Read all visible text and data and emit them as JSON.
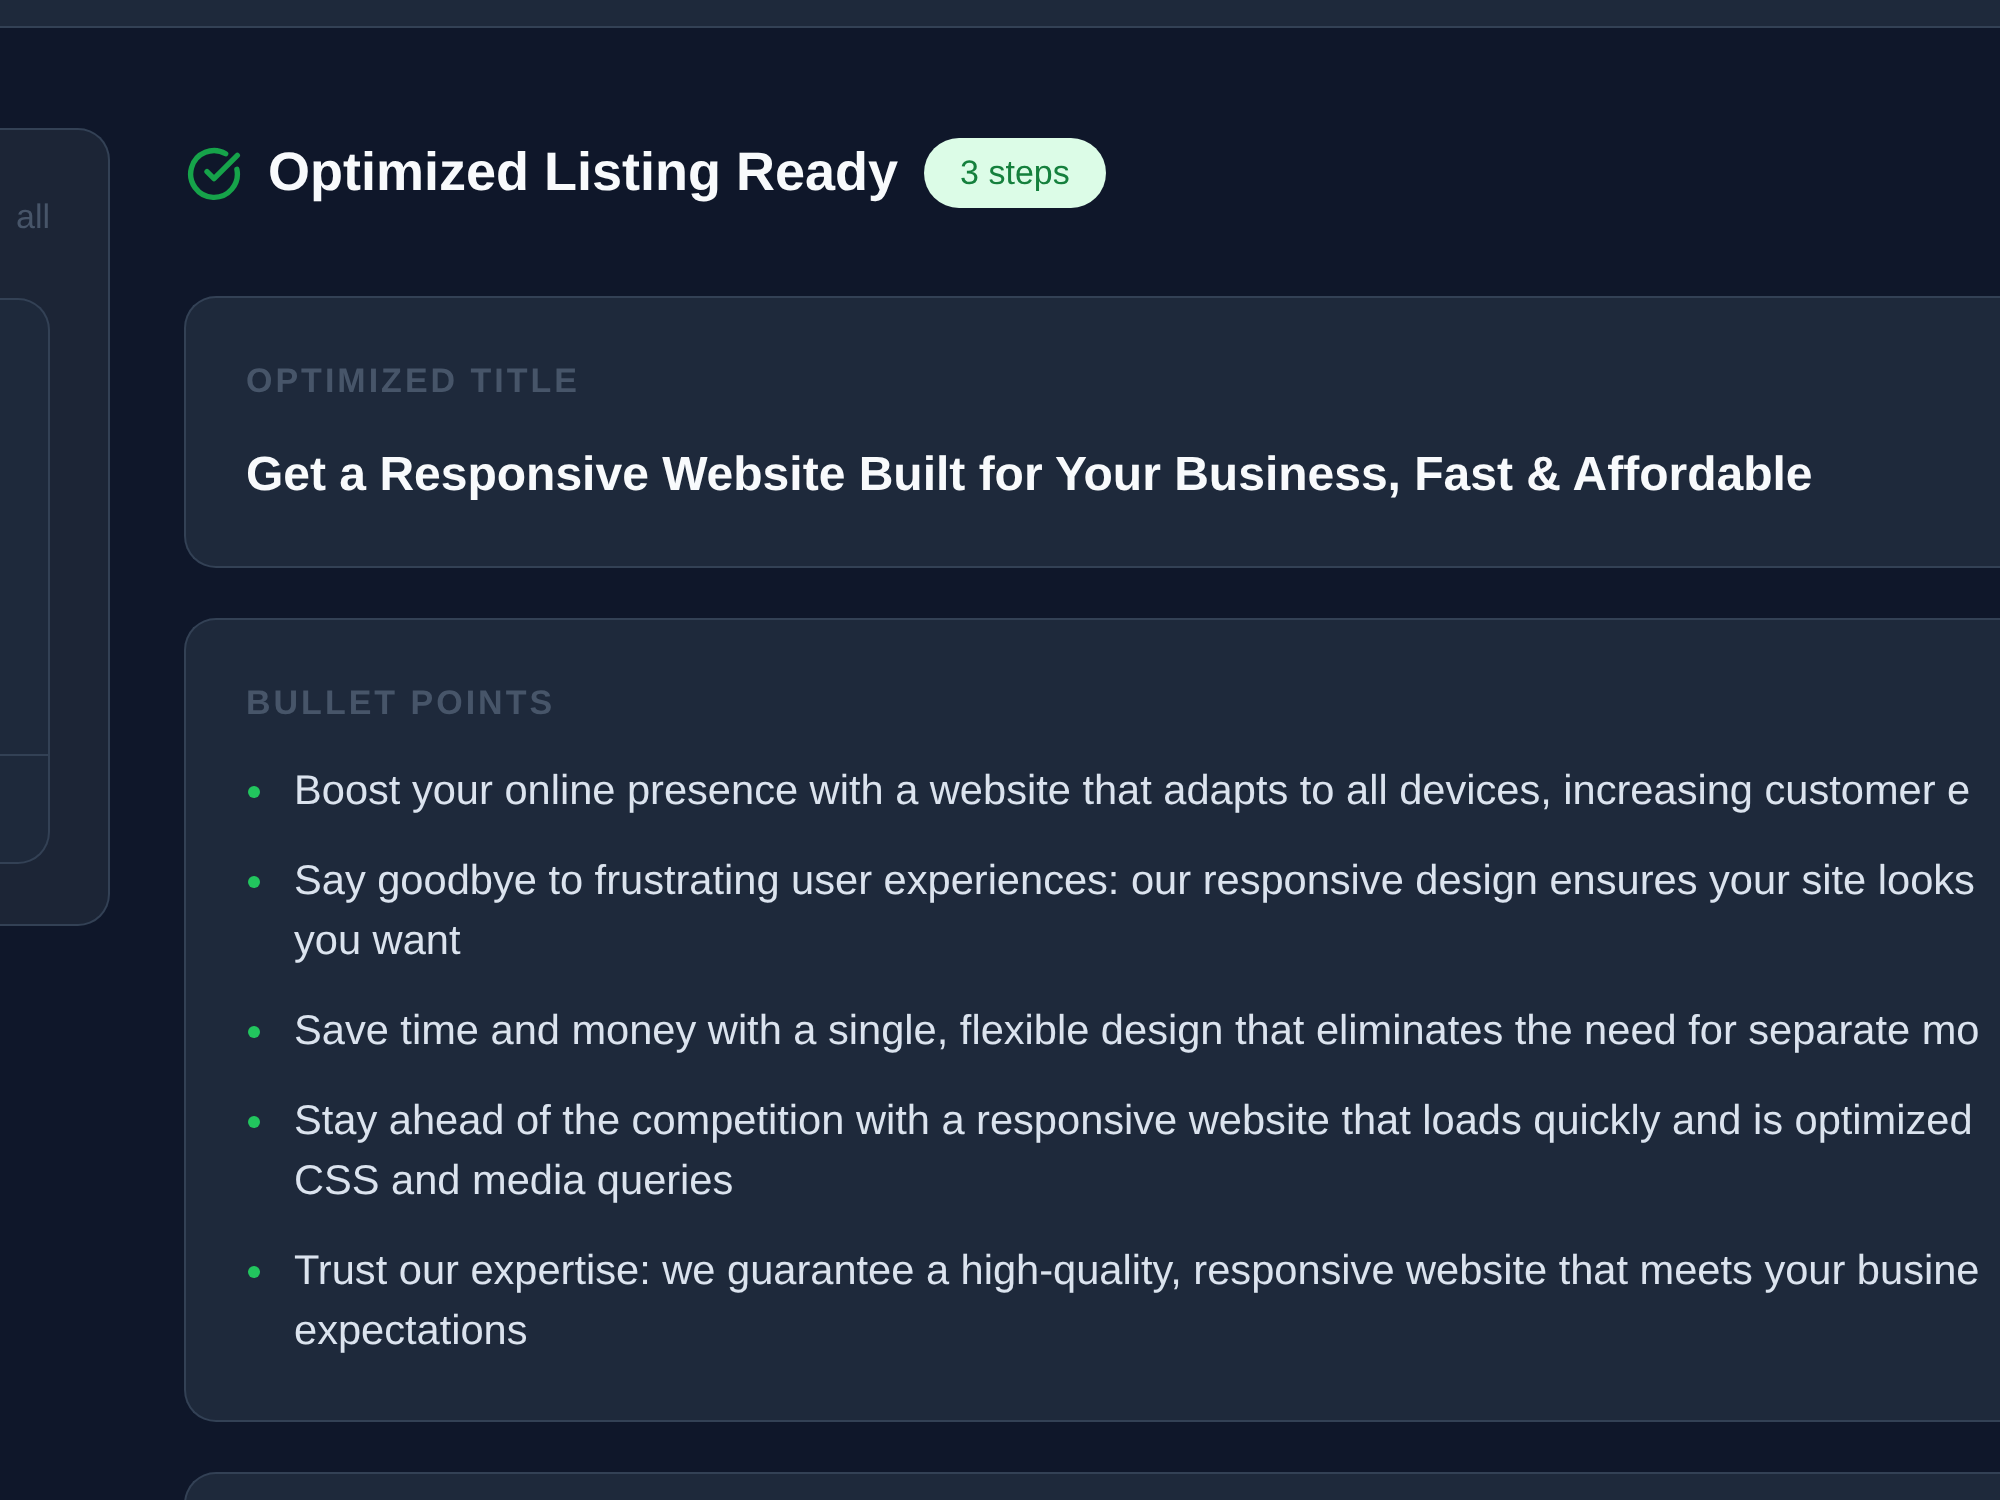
{
  "side_panel": {
    "text": "all"
  },
  "header": {
    "title": "Optimized Listing Ready",
    "badge": "3 steps"
  },
  "sections": [
    {
      "kind": "title",
      "label": "OPTIMIZED TITLE",
      "text": "Get a Responsive Website Built for Your Business, Fast & Affordable"
    },
    {
      "kind": "bullets",
      "label": "BULLET POINTS",
      "items": [
        {
          "lines": [
            "Boost your online presence with a website that adapts to all devices, increasing customer e"
          ]
        },
        {
          "lines": [
            "Say goodbye to frustrating user experiences: our responsive design ensures your site looks",
            "you want"
          ]
        },
        {
          "lines": [
            "Save time and money with a single, flexible design that eliminates the need for separate mo"
          ]
        },
        {
          "lines": [
            "Stay ahead of the competition with a responsive website that loads quickly and is optimized",
            "CSS and media queries"
          ]
        },
        {
          "lines": [
            "Trust our expertise: we guarantee a high-quality, responsive website that meets your busine",
            "expectations"
          ]
        }
      ]
    },
    {
      "kind": "card"
    }
  ]
}
